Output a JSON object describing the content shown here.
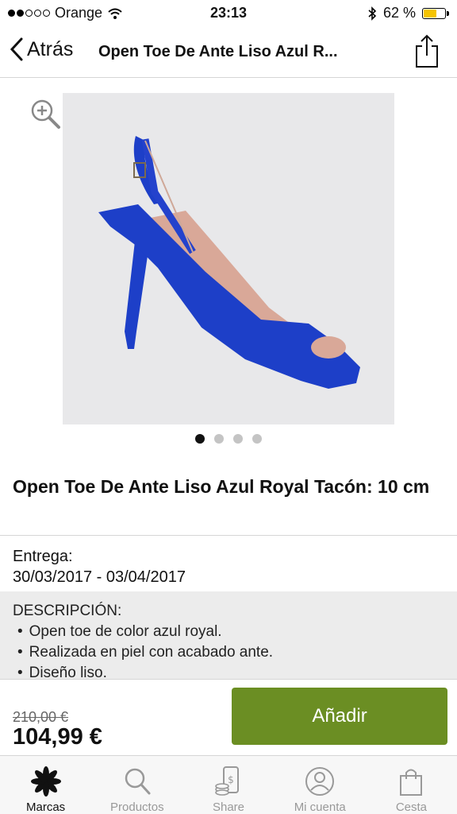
{
  "status_bar": {
    "carrier": "Orange",
    "time": "23:13",
    "battery_percent": "62 %",
    "battery_level": 0.62
  },
  "nav": {
    "back_label": "Atrás",
    "title": "Open Toe De Ante Liso Azul R..."
  },
  "gallery": {
    "dot_count": 4,
    "active_index": 0,
    "shoe_color": "#1d3fc8"
  },
  "product": {
    "title": "Open Toe De Ante Liso Azul Royal Tacón: 10 cm"
  },
  "delivery": {
    "label": "Entrega:",
    "dates": "30/03/2017 - 03/04/2017"
  },
  "description": {
    "heading": "DESCRIPCIÓN:",
    "items": [
      "Open toe de color azul royal.",
      "Realizada en piel con acabado ante.",
      "Diseño liso."
    ]
  },
  "price": {
    "old": "210,00 €",
    "current": "104,99 €",
    "add_label": "Añadir"
  },
  "tabs": [
    {
      "label": "Marcas",
      "icon": "flower-icon",
      "active": true
    },
    {
      "label": "Productos",
      "icon": "search-icon",
      "active": false
    },
    {
      "label": "Share",
      "icon": "phone-coins-icon",
      "active": false
    },
    {
      "label": "Mi cuenta",
      "icon": "user-icon",
      "active": false
    },
    {
      "label": "Cesta",
      "icon": "bag-icon",
      "active": false
    }
  ],
  "colors": {
    "accent": "#6b8e23",
    "battery": "#f5c400"
  }
}
